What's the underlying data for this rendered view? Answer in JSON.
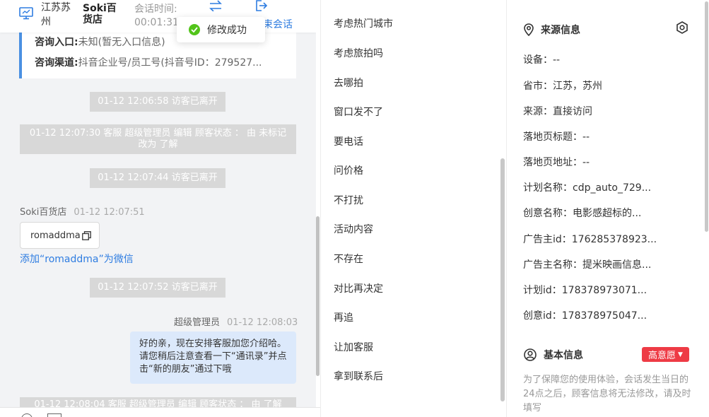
{
  "header": {
    "location": "江苏苏州",
    "store_name": "Soki百货店",
    "session_time_label": "会话时间:",
    "session_time_value": "00:01:31",
    "end_chat_label": "束会话"
  },
  "toast": {
    "text": "修改成功"
  },
  "consult_info": {
    "entry_label": "咨询入口:",
    "entry_value": "未知(暂无入口信息)",
    "channel_label": "咨询渠道:",
    "channel_value": "抖音企业号/员工号(抖音号ID：279527..."
  },
  "messages": {
    "sys1": "01-12 12:06:58 访客已离开",
    "sys2": "01-12 12:07:30 客服 超级管理员 编辑 顾客状态 ： 由 未标记 改为 了解",
    "sys3": "01-12 12:07:44 访客已离开",
    "store_sender": "Soki百货店",
    "store_time": "01-12 12:07:51",
    "text_card": "romaddma",
    "add_wechat": "添加“romaddma”为微信",
    "sys4": "01-12 12:07:52 访客已离开",
    "agent_sender": "超级管理员",
    "agent_time": "01-12 12:08:03",
    "agent_bubble": "好的亲，现在安排客服加您介绍哈。请您稍后注意查看一下“通讯录”并点击“新的朋友”通过下哦",
    "sys5": "01-12 12:08:04 客服 超级管理员 编辑 顾客状态 ： 由 了解"
  },
  "quick_replies": [
    "考虑热门城市",
    "考虑旅拍吗",
    "去哪拍",
    "窗口发不了",
    "要电话",
    "问价格",
    "不打扰",
    "活动内容",
    "不存在",
    "对比再决定",
    "再追",
    "让加客服",
    "拿到联系后"
  ],
  "source_info": {
    "title": "来源信息",
    "fields": [
      "设备：--",
      "省市：江苏，苏州",
      "来源：直接访问",
      "落地页标题：--",
      "落地页地址：--",
      "计划名称：cdp_auto_729...",
      "创意名称：电影感超标的...",
      "广告主id：176285378923...",
      "广告主名称：提米映画信息...",
      "计划id：178378973071...",
      "创意id：178378975047..."
    ]
  },
  "basic_info": {
    "title": "基本信息",
    "intent_badge": "高意愿",
    "notice": "为了保障您的使用体验，会话发生当日的24点之后，顾客信息将无法修改，请及时填写"
  },
  "colors": {
    "link_blue": "#2f7de1",
    "accent_bar": "#4a90e2",
    "toast_success": "#52c41a",
    "badge_red": "#ee3b45",
    "bubble_blue": "#dce9fb"
  }
}
